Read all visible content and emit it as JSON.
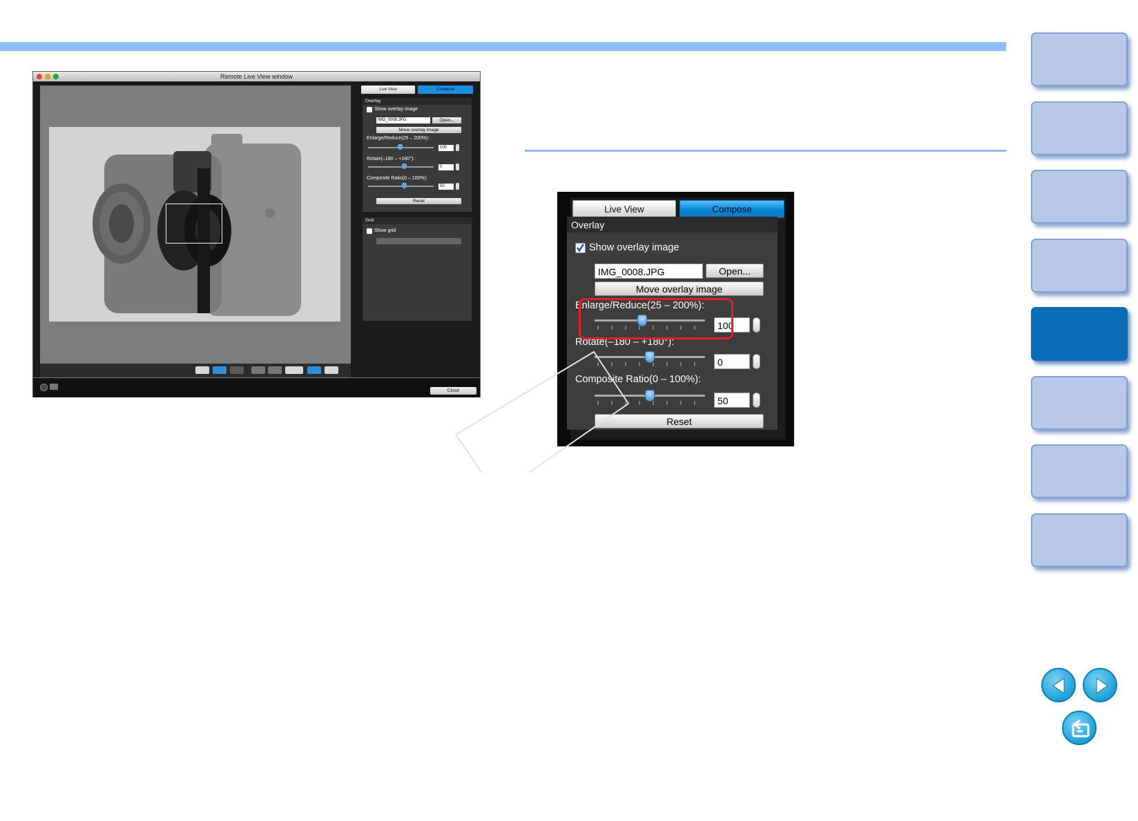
{
  "window": {
    "title": "Remote Live View window",
    "close_label": "Close",
    "panel": {
      "tabs": [
        "Live View",
        "Compose"
      ],
      "overlay_header": "Overlay",
      "show_overlay_label": "Show overlay image",
      "filename": "IMG_0008.JPG",
      "open_label": "Open...",
      "move_label": "Move overlay image",
      "enlarge_label": "Enlarge/Reduce(25 – 200%):",
      "enlarge_value": "100",
      "rotate_label": "Rotate(–180 – +180°):",
      "rotate_value": "0",
      "composite_label": "Composite Ratio(0 – 100%):",
      "composite_value": "50",
      "reset_label": "Reset",
      "grid_header": "Grid",
      "show_grid_label": "Show grid"
    }
  },
  "zoom_panel": {
    "tab_live": "Live View",
    "tab_compose": "Compose",
    "overlay_header": "Overlay",
    "show_overlay_label": "Show overlay image",
    "filename": "IMG_0008.JPG",
    "open_label": "Open...",
    "move_label": "Move overlay image",
    "enlarge_label": "Enlarge/Reduce(25 – 200%):",
    "enlarge_value": "100",
    "enlarge_level": 0.43,
    "rotate_label": "Rotate(–180 – +180°):",
    "rotate_value": "0",
    "rotate_level": 0.5,
    "composite_label": "Composite Ratio(0 – 100%):",
    "composite_value": "50",
    "composite_level": 0.5,
    "reset_label": "Reset"
  },
  "colors": {
    "accent_blue": "#8dbff6",
    "active_tab": "#0a6cb9",
    "inactive_tab": "#b7c9e6",
    "highlight_red": "#e41f26"
  },
  "icons": [
    "previous-page-icon",
    "next-page-icon",
    "return-icon"
  ]
}
